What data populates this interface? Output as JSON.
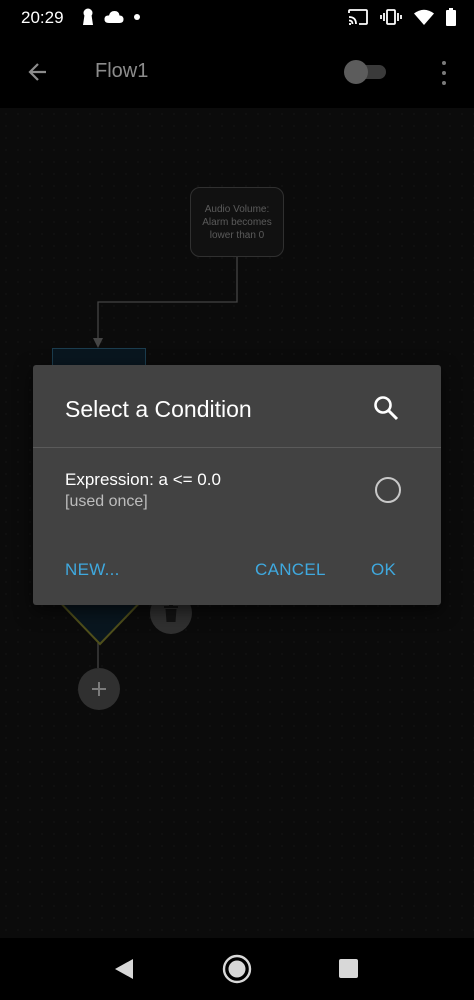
{
  "status_bar": {
    "time": "20:29",
    "left_icons": [
      "keyhole-icon",
      "cloud-icon",
      "dot-icon"
    ],
    "right_icons": [
      "cast-icon",
      "vibrate-icon",
      "wifi-icon",
      "battery-icon"
    ]
  },
  "app_bar": {
    "title": "Flow1",
    "back_icon": "arrow-back-icon",
    "toggle_state": "off",
    "overflow_icon": "more-vert-icon"
  },
  "flow": {
    "trigger_node": {
      "line1": "Audio Volume:",
      "line2": "Alarm becomes",
      "line3": "lower than 0"
    }
  },
  "dialog": {
    "title": "Select a Condition",
    "search_icon": "search-icon",
    "conditions": [
      {
        "label": "Expression: a <= 0.0",
        "usage": "[used once]",
        "selected": false
      }
    ],
    "buttons": {
      "new": "NEW...",
      "cancel": "CANCEL",
      "ok": "OK"
    }
  },
  "colors": {
    "accent": "#3fa9df",
    "dialog_bg": "#424242",
    "canvas_bg": "#111111",
    "action_node_border": "#2a5c78",
    "decision_border": "#7a7a2a"
  }
}
